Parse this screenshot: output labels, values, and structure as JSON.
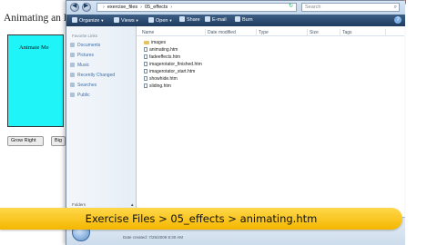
{
  "background_page": {
    "title": "Animating an Ele",
    "box_label": "Animate Me",
    "box_color": "#1ff4f8",
    "buttons": [
      "Grow Right",
      "Big"
    ]
  },
  "explorer": {
    "address": [
      "exercise_files",
      "05_effects"
    ],
    "search_placeholder": "Search",
    "toolbar": {
      "organize": "Organize",
      "views": "Views",
      "open": "Open",
      "share": "Share",
      "email": "E-mail",
      "burn": "Burn"
    },
    "nav": {
      "favorites_header": "Favorite Links",
      "items": [
        "Documents",
        "Pictures",
        "Music",
        "Recently Changed",
        "Searches",
        "Public"
      ],
      "folders_label": "Folders"
    },
    "columns": [
      "Name",
      "Date modified",
      "Type",
      "Size",
      "Tags"
    ],
    "files": [
      {
        "name": "images",
        "kind": "folder"
      },
      {
        "name": "animating.htm",
        "kind": "file"
      },
      {
        "name": "fadeeffects.htm",
        "kind": "file"
      },
      {
        "name": "imagerotator_finished.htm",
        "kind": "file"
      },
      {
        "name": "imagerotator_start.htm",
        "kind": "file"
      },
      {
        "name": "showhide.htm",
        "kind": "file"
      },
      {
        "name": "sliding.htm",
        "kind": "file"
      }
    ],
    "details": {
      "date_created": "Date created: 7/25/2009 8:30 AM"
    }
  },
  "banner": {
    "text": "Exercise Files > 05_effects > animating.htm",
    "color": "#f4b600"
  }
}
